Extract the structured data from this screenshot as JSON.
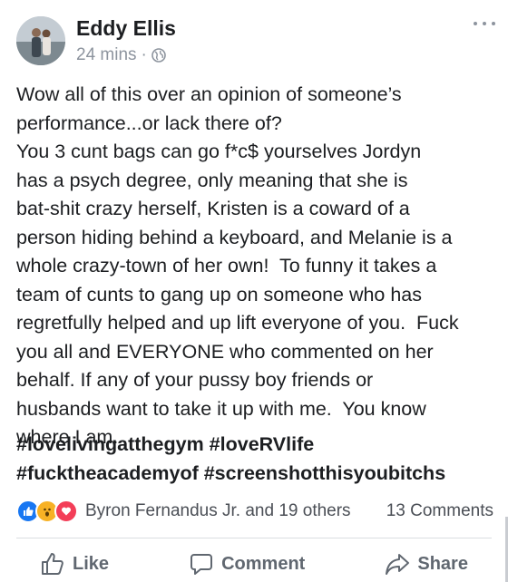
{
  "post": {
    "author": "Eddy Ellis",
    "time": "24 mins",
    "separator": "·",
    "privacy_icon": "globe-icon",
    "more_icon": "more-horizontal-icon",
    "text": "Wow all of this over an opinion of someone’s\nperformance...or lack there of?\nYou 3 cunt bags can go f*c$ yourselves Jordyn\nhas a psych degree, only meaning that she is\nbat-shit crazy herself, Kristen is a coward of a\nperson hiding behind a keyboard, and Melanie is a\nwhole crazy-town of her own!  To funny it takes a\nteam of cunts to gang up on someone who has\nregretfully helped and up lift everyone of you.  Fuck\nyou all and EVERYONE who commented on her\nbehalf. If any of your pussy boy friends or\nhusbands want to take it up with me.  You know\nwhere I am.",
    "hashtags": [
      "#lovelivingatthegym #loveRVlife",
      "#fucktheacademyof #screenshotthisyoubitchs"
    ]
  },
  "reactions": {
    "icons": [
      "like-reaction-icon",
      "wow-reaction-icon",
      "love-reaction-icon"
    ],
    "names": "Byron Fernandus Jr. and 19 others",
    "comments": "13 Comments"
  },
  "actions": {
    "like": "Like",
    "comment": "Comment",
    "share": "Share"
  },
  "colors": {
    "text": "#1c1e21",
    "secondary": "#8d949e",
    "action": "#606770",
    "like_blue": "#1877f2",
    "wow_yellow": "#f7b125",
    "love_red": "#f33e58"
  }
}
